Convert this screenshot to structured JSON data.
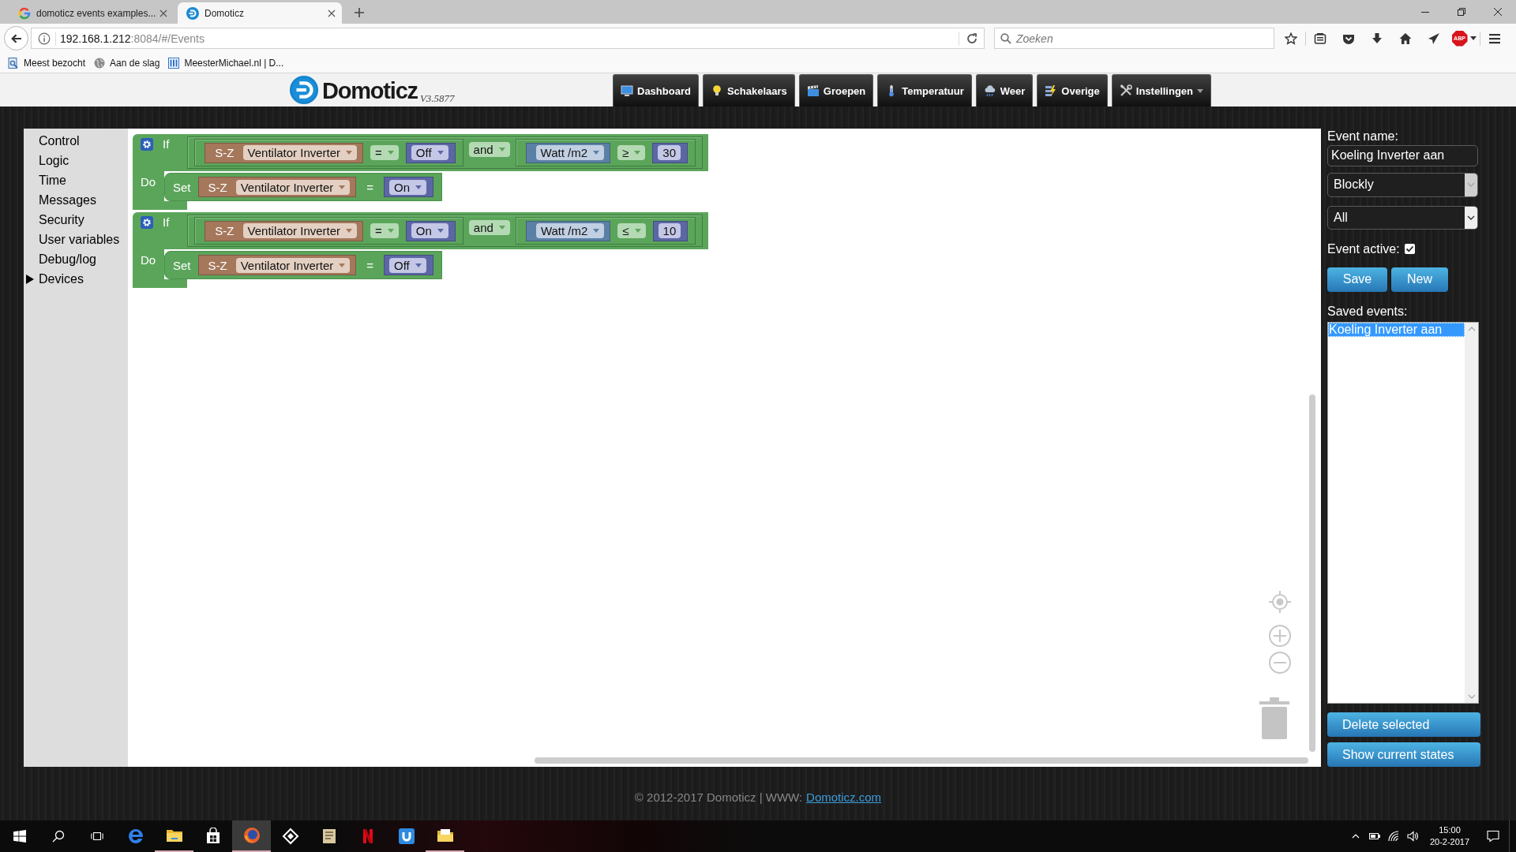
{
  "browser": {
    "tabs": [
      {
        "title": "domoticz events examples...",
        "kind": "letter",
        "selected": false
      },
      {
        "title": "Domoticz",
        "kind": "logo",
        "selected": true
      }
    ],
    "address": {
      "host": "192.168.1.212",
      "path": ":8084/#/Events"
    },
    "search": {
      "placeholder": "Zoeken"
    },
    "addon_badge": "ABP",
    "bookmarks": [
      {
        "label": "Meest bezocht",
        "kind": "page"
      },
      {
        "label": "Aan de slag",
        "kind": "globe"
      },
      {
        "label": "MeesterMichael.nl | D...",
        "kind": "columns"
      }
    ]
  },
  "header": {
    "logo": "Domoticz",
    "version": "V3.5877",
    "nav": [
      {
        "label": "Dashboard",
        "kind": "monitor",
        "dropdown": false
      },
      {
        "label": "Schakelaars",
        "kind": "bulb",
        "dropdown": false
      },
      {
        "label": "Groepen",
        "kind": "clapper",
        "dropdown": false
      },
      {
        "label": "Temperatuur",
        "kind": "thermometer",
        "dropdown": false
      },
      {
        "label": "Weer",
        "kind": "cloud",
        "dropdown": false
      },
      {
        "label": "Overige",
        "kind": "lightning",
        "dropdown": false
      },
      {
        "label": "Instellingen",
        "kind": "tools",
        "dropdown": true
      }
    ]
  },
  "toolbox": [
    {
      "label": "Control",
      "kind": "category"
    },
    {
      "label": "Logic",
      "kind": "category"
    },
    {
      "label": "Time",
      "kind": "category"
    },
    {
      "label": "Messages",
      "kind": "category"
    },
    {
      "label": "Security",
      "kind": "category"
    },
    {
      "label": "User variables",
      "kind": "category"
    },
    {
      "label": "Debug/log",
      "kind": "category"
    },
    {
      "label": "Devices",
      "kind": "group"
    }
  ],
  "blocks": [
    {
      "if_label": "If",
      "join": "and",
      "comparisons": [
        {
          "kind": "device",
          "prefix": "S-Z",
          "name": "Ventilator Inverter",
          "operator": "=",
          "value": "Off",
          "value_dropdown": true
        },
        {
          "kind": "variable",
          "name": "Watt /m2",
          "operator": "≥",
          "value": "30",
          "value_dropdown": false
        }
      ],
      "do_label": "Do",
      "action": {
        "set_label": "Set",
        "prefix": "S-Z",
        "name": "Ventilator Inverter",
        "operator": "=",
        "value": "On",
        "value_dropdown": true
      }
    },
    {
      "if_label": "If",
      "join": "and",
      "comparisons": [
        {
          "kind": "device",
          "prefix": "S-Z",
          "name": "Ventilator Inverter",
          "operator": "=",
          "value": "On",
          "value_dropdown": true
        },
        {
          "kind": "variable",
          "name": "Watt /m2",
          "operator": "≤",
          "value": "10",
          "value_dropdown": false
        }
      ],
      "do_label": "Do",
      "action": {
        "set_label": "Set",
        "prefix": "S-Z",
        "name": "Ventilator Inverter",
        "operator": "=",
        "value": "Off",
        "value_dropdown": true
      }
    }
  ],
  "panel": {
    "event_name": {
      "label": "Event name:",
      "value": "Koeling Inverter aan"
    },
    "interpreter": {
      "value": "Blockly",
      "disabled": true
    },
    "filter": {
      "value": "All",
      "disabled": false
    },
    "active": {
      "label": "Event active:",
      "checked": true
    },
    "actions": [
      "Save",
      "New"
    ],
    "saved": {
      "label": "Saved events:",
      "items": [
        {
          "name": "Koeling Inverter aan",
          "selected": true
        }
      ]
    },
    "bottom_actions": [
      "Delete selected",
      "Show current states"
    ]
  },
  "footer": {
    "text": "© 2012-2017 Domoticz | WWW:",
    "link": "Domoticz.com"
  },
  "taskbar": {
    "apps": [
      {
        "kind": "e",
        "running": false,
        "active": false
      },
      {
        "kind": "folder",
        "running": true,
        "active": false
      },
      {
        "kind": "bag",
        "running": false,
        "active": false
      },
      {
        "kind": "globe",
        "running": true,
        "active": true
      },
      {
        "kind": "diamond",
        "running": false,
        "active": false
      },
      {
        "kind": "scroll",
        "running": false,
        "active": false
      },
      {
        "kind": "n",
        "running": false,
        "active": false
      },
      {
        "kind": "tile",
        "running": false,
        "active": false
      },
      {
        "kind": "folder-doc",
        "running": true,
        "active": false
      }
    ],
    "time": "15:00",
    "date": "20-2-2017"
  }
}
